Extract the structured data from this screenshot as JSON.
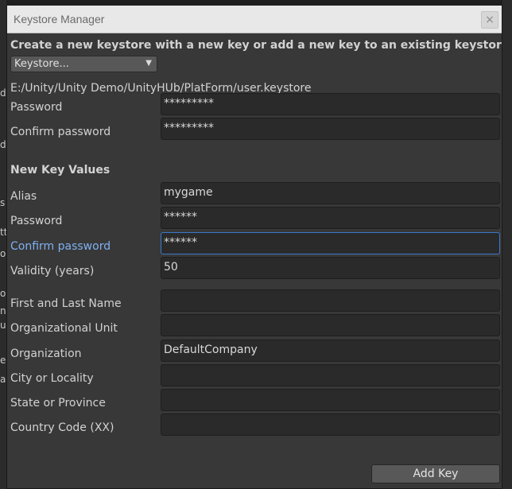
{
  "background": {
    "left_fragments": [
      "d",
      "d",
      "s",
      "tt",
      "or",
      "or",
      "na",
      "u",
      "e",
      "al"
    ]
  },
  "window": {
    "title": "Keystore Manager",
    "close_label": "×"
  },
  "header": {
    "text": "Create a new keystore with a new key or add a new key to an existing keystore"
  },
  "keystore_dropdown": {
    "selected": "Keystore..."
  },
  "keystore_path": "E:/Unity/Unity Demo/UnityHUb/PlatForm/user.keystore",
  "keystore_fields": {
    "password_label": "Password",
    "password_value": "*********",
    "confirm_label": "Confirm password",
    "confirm_value": "*********"
  },
  "new_key": {
    "section_title": "New Key Values",
    "alias_label": "Alias",
    "alias_value": "mygame",
    "password_label": "Password",
    "password_value": "******",
    "confirm_label": "Confirm password",
    "confirm_value": "******",
    "validity_label": "Validity (years)",
    "validity_value": "50",
    "name_label": "First and Last Name",
    "name_value": "",
    "unit_label": "Organizational Unit",
    "unit_value": "",
    "org_label": "Organization",
    "org_value": "DefaultCompany",
    "city_label": "City or Locality",
    "city_value": "",
    "state_label": "State or Province",
    "state_value": "",
    "country_label": "Country Code (XX)",
    "country_value": ""
  },
  "actions": {
    "add_key_label": "Add Key"
  },
  "colors": {
    "window_bg": "#383838",
    "field_bg": "#2a2a2a",
    "focus_accent": "#3a79c9",
    "focus_label": "#7fb0f0"
  }
}
